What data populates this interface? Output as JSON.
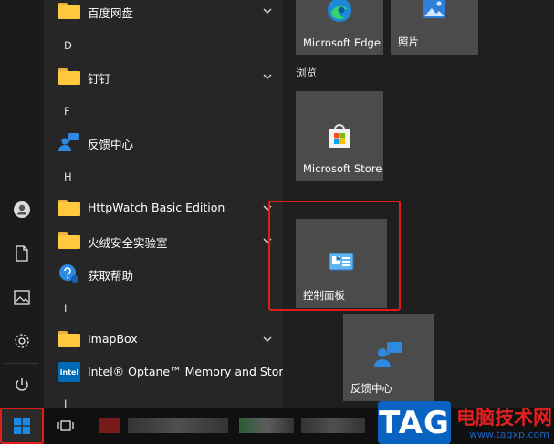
{
  "app_list": {
    "items": [
      {
        "kind": "folder",
        "label": "百度网盘",
        "expandable": true
      },
      {
        "kind": "letter",
        "label": "D"
      },
      {
        "kind": "folder",
        "label": "钉钉",
        "expandable": true
      },
      {
        "kind": "letter",
        "label": "F"
      },
      {
        "kind": "app",
        "label": "反馈中心",
        "icon": "feedback-hub-icon"
      },
      {
        "kind": "letter",
        "label": "H"
      },
      {
        "kind": "folder",
        "label": "HttpWatch Basic Edition",
        "expandable": true
      },
      {
        "kind": "folder",
        "label": "火绒安全实验室",
        "expandable": true
      },
      {
        "kind": "app",
        "label": "获取帮助",
        "icon": "get-help-icon"
      },
      {
        "kind": "letter",
        "label": "I"
      },
      {
        "kind": "folder",
        "label": "ImapBox",
        "expandable": true
      },
      {
        "kind": "app",
        "label": "Intel® Optane™ Memory and Stor...",
        "icon": "intel-icon",
        "icon_text": "intel"
      },
      {
        "kind": "letter",
        "label": "J"
      }
    ]
  },
  "tiles": {
    "group_title": "浏览",
    "items": [
      {
        "label": "Microsoft Edge",
        "icon": "edge-icon"
      },
      {
        "label": "照片",
        "icon": "photos-icon"
      },
      {
        "label": "Microsoft Store",
        "icon": "store-icon"
      },
      {
        "label": "控制面板",
        "icon": "control-panel-icon"
      },
      {
        "label": "反馈中心",
        "icon": "feedback-hub-icon"
      }
    ]
  },
  "watermark": {
    "badge": "TAG",
    "title": "电脑技术网",
    "url": "www.tagxp.com"
  },
  "colors": {
    "highlight": "#e21b1b",
    "tile": "#4b4b4b",
    "list_bg": "#262626",
    "folder": "#ffc83d",
    "accent_blue": "#0078d4"
  }
}
